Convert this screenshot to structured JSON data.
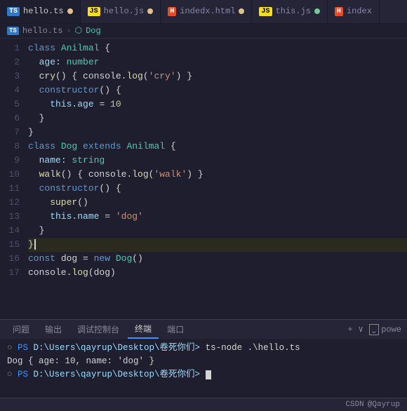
{
  "tabs": [
    {
      "id": "tab1",
      "icon_type": "ts",
      "label": "hello.ts",
      "dot": "yellow",
      "active": true
    },
    {
      "id": "tab2",
      "icon_type": "js",
      "label": "hello.js",
      "dot": "yellow",
      "active": false
    },
    {
      "id": "tab3",
      "icon_type": "html",
      "label": "indedx.html",
      "dot": "yellow",
      "active": false
    },
    {
      "id": "tab4",
      "icon_type": "js",
      "label": "this.js",
      "dot": "green",
      "active": false
    },
    {
      "id": "tab5",
      "icon_type": "html",
      "label": "index",
      "dot": "none",
      "active": false
    }
  ],
  "breadcrumb": {
    "file": "hello.ts",
    "separator": ">",
    "symbol": "Dog"
  },
  "lines": [
    {
      "num": 1,
      "tokens": [
        {
          "t": "kw",
          "v": "class "
        },
        {
          "t": "cls",
          "v": "Anilmal"
        },
        {
          "t": "plain",
          "v": " {"
        }
      ]
    },
    {
      "num": 2,
      "tokens": [
        {
          "t": "prop",
          "v": "  age"
        },
        {
          "t": "plain",
          "v": ": "
        },
        {
          "t": "type",
          "v": "number"
        }
      ]
    },
    {
      "num": 3,
      "tokens": [
        {
          "t": "method",
          "v": "  cry"
        },
        {
          "t": "plain",
          "v": "() { console."
        },
        {
          "t": "method",
          "v": "log"
        },
        {
          "t": "plain",
          "v": "("
        },
        {
          "t": "str",
          "v": "'cry'"
        },
        {
          "t": "plain",
          "v": ") }"
        }
      ]
    },
    {
      "num": 4,
      "tokens": [
        {
          "t": "kw",
          "v": "  constructor"
        },
        {
          "t": "plain",
          "v": "() {"
        }
      ]
    },
    {
      "num": 5,
      "tokens": [
        {
          "t": "kw-this",
          "v": "    this"
        },
        {
          "t": "plain",
          "v": "."
        },
        {
          "t": "prop",
          "v": "age"
        },
        {
          "t": "plain",
          "v": " = "
        },
        {
          "t": "num",
          "v": "10"
        }
      ]
    },
    {
      "num": 6,
      "tokens": [
        {
          "t": "plain",
          "v": "  }"
        }
      ]
    },
    {
      "num": 7,
      "tokens": [
        {
          "t": "plain",
          "v": "}"
        }
      ]
    },
    {
      "num": 8,
      "tokens": [
        {
          "t": "kw",
          "v": "class "
        },
        {
          "t": "cls",
          "v": "Dog"
        },
        {
          "t": "plain",
          "v": " "
        },
        {
          "t": "kw",
          "v": "extends"
        },
        {
          "t": "plain",
          "v": " "
        },
        {
          "t": "cls",
          "v": "Anilmal"
        },
        {
          "t": "plain",
          "v": " {"
        }
      ]
    },
    {
      "num": 9,
      "tokens": [
        {
          "t": "prop",
          "v": "  name"
        },
        {
          "t": "plain",
          "v": ": "
        },
        {
          "t": "type",
          "v": "string"
        }
      ]
    },
    {
      "num": 10,
      "tokens": [
        {
          "t": "method",
          "v": "  walk"
        },
        {
          "t": "plain",
          "v": "() { console."
        },
        {
          "t": "method",
          "v": "log"
        },
        {
          "t": "plain",
          "v": "("
        },
        {
          "t": "str",
          "v": "'walk'"
        },
        {
          "t": "plain",
          "v": ") }"
        }
      ]
    },
    {
      "num": 11,
      "tokens": [
        {
          "t": "kw",
          "v": "  constructor"
        },
        {
          "t": "plain",
          "v": "() {"
        }
      ]
    },
    {
      "num": 12,
      "tokens": [
        {
          "t": "method",
          "v": "    super"
        },
        {
          "t": "plain",
          "v": "()"
        }
      ]
    },
    {
      "num": 13,
      "tokens": [
        {
          "t": "kw-this",
          "v": "    this"
        },
        {
          "t": "plain",
          "v": "."
        },
        {
          "t": "prop",
          "v": "name"
        },
        {
          "t": "plain",
          "v": " = "
        },
        {
          "t": "str",
          "v": "'dog'"
        }
      ]
    },
    {
      "num": 14,
      "tokens": [
        {
          "t": "plain",
          "v": "  }"
        }
      ]
    },
    {
      "num": 15,
      "tokens": [
        {
          "t": "plain",
          "v": "}"
        }
      ],
      "highlighted": true
    },
    {
      "num": 16,
      "tokens": [
        {
          "t": "kw",
          "v": "const"
        },
        {
          "t": "plain",
          "v": " dog = "
        },
        {
          "t": "kw",
          "v": "new"
        },
        {
          "t": "plain",
          "v": " "
        },
        {
          "t": "cls",
          "v": "Dog"
        },
        {
          "t": "plain",
          "v": "()"
        }
      ]
    },
    {
      "num": 17,
      "tokens": [
        {
          "t": "plain",
          "v": "console."
        },
        {
          "t": "method",
          "v": "log"
        },
        {
          "t": "plain",
          "v": "(dog)"
        }
      ]
    }
  ],
  "terminal": {
    "tabs": [
      {
        "label": "问题",
        "active": false
      },
      {
        "label": "输出",
        "active": false
      },
      {
        "label": "调试控制台",
        "active": false
      },
      {
        "label": "终端",
        "active": true
      },
      {
        "label": "端口",
        "active": false
      }
    ],
    "lines": [
      {
        "type": "prompt",
        "prompt": "PS",
        "path": " D:\\Users\\qayrup\\Desktop\\卷死你们>",
        "cmd": " ts-node .\\hello.ts"
      },
      {
        "type": "output",
        "text": "Dog { age: 10, name: 'dog' }"
      },
      {
        "type": "prompt",
        "prompt": "PS",
        "path": " D:\\Users\\qayrup\\Desktop\\卷死你们>",
        "cmd": " "
      }
    ]
  },
  "status_bar": {
    "left": "CSDN",
    "right": "@Qayrup"
  }
}
